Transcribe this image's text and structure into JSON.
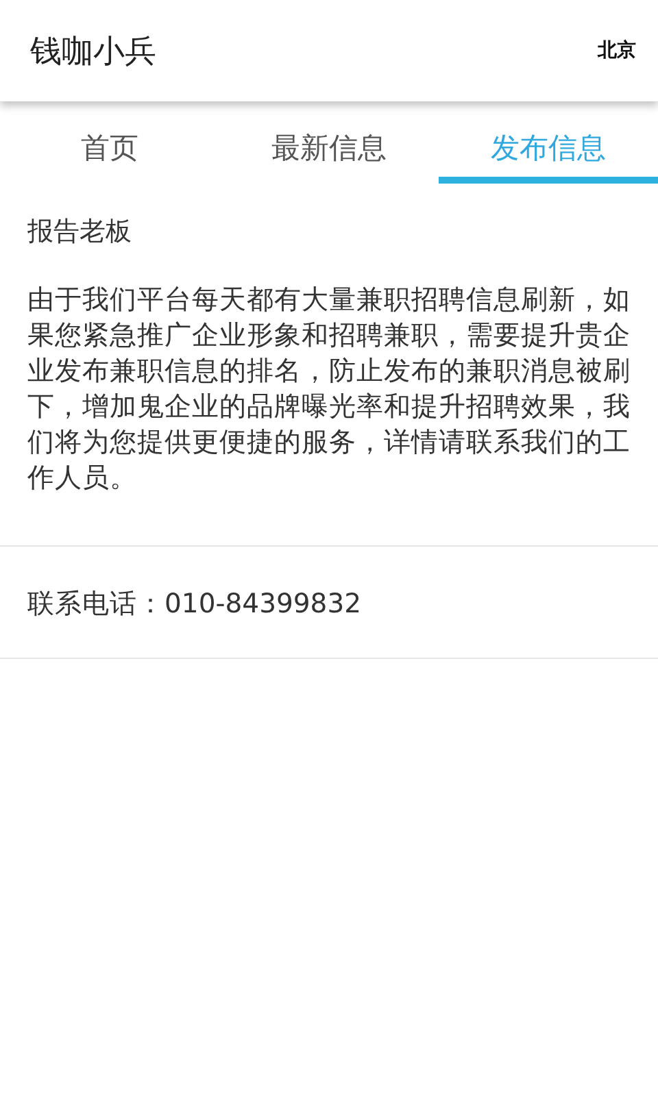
{
  "app_bar": {
    "title": "钱咖小兵",
    "city": "北京"
  },
  "tabs": [
    {
      "label": "首页",
      "selected": false
    },
    {
      "label": "最新信息",
      "selected": false
    },
    {
      "label": "发布信息",
      "selected": true
    }
  ],
  "notice": {
    "heading": "报告老板",
    "body": "由于我们平台每天都有大量兼职招聘信息刷新，如果您紧急推广企业形象和招聘兼职，需要提升贵企业发布兼职信息的排名，防止发布的兼职消息被刷下，增加鬼企业的品牌曝光率和提升招聘效果，我们将为您提供更便捷的服务，详情请联系我们的工作人员。"
  },
  "contact": "联系电话：010-84399832"
}
